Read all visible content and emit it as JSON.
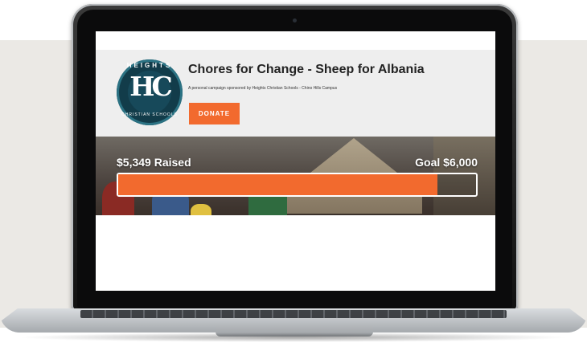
{
  "campaign": {
    "title": "Chores for Change - Sheep for Albania",
    "subtitle": "A personal campaign sponsored by Heights Christian Schools - Chino Hills Campus",
    "donate_label": "DONATE"
  },
  "logo": {
    "top_text": "HEIGHTS",
    "monogram": "HC",
    "bottom_text": "CHRISTIAN SCHOOLS"
  },
  "progress": {
    "raised_label": "$5,349 Raised",
    "goal_label": "Goal $6,000",
    "fraction": 0.8915
  },
  "colors": {
    "accent": "#f26a2e",
    "header_bg": "#eeeeee",
    "logo_bg": "#123c4a"
  }
}
